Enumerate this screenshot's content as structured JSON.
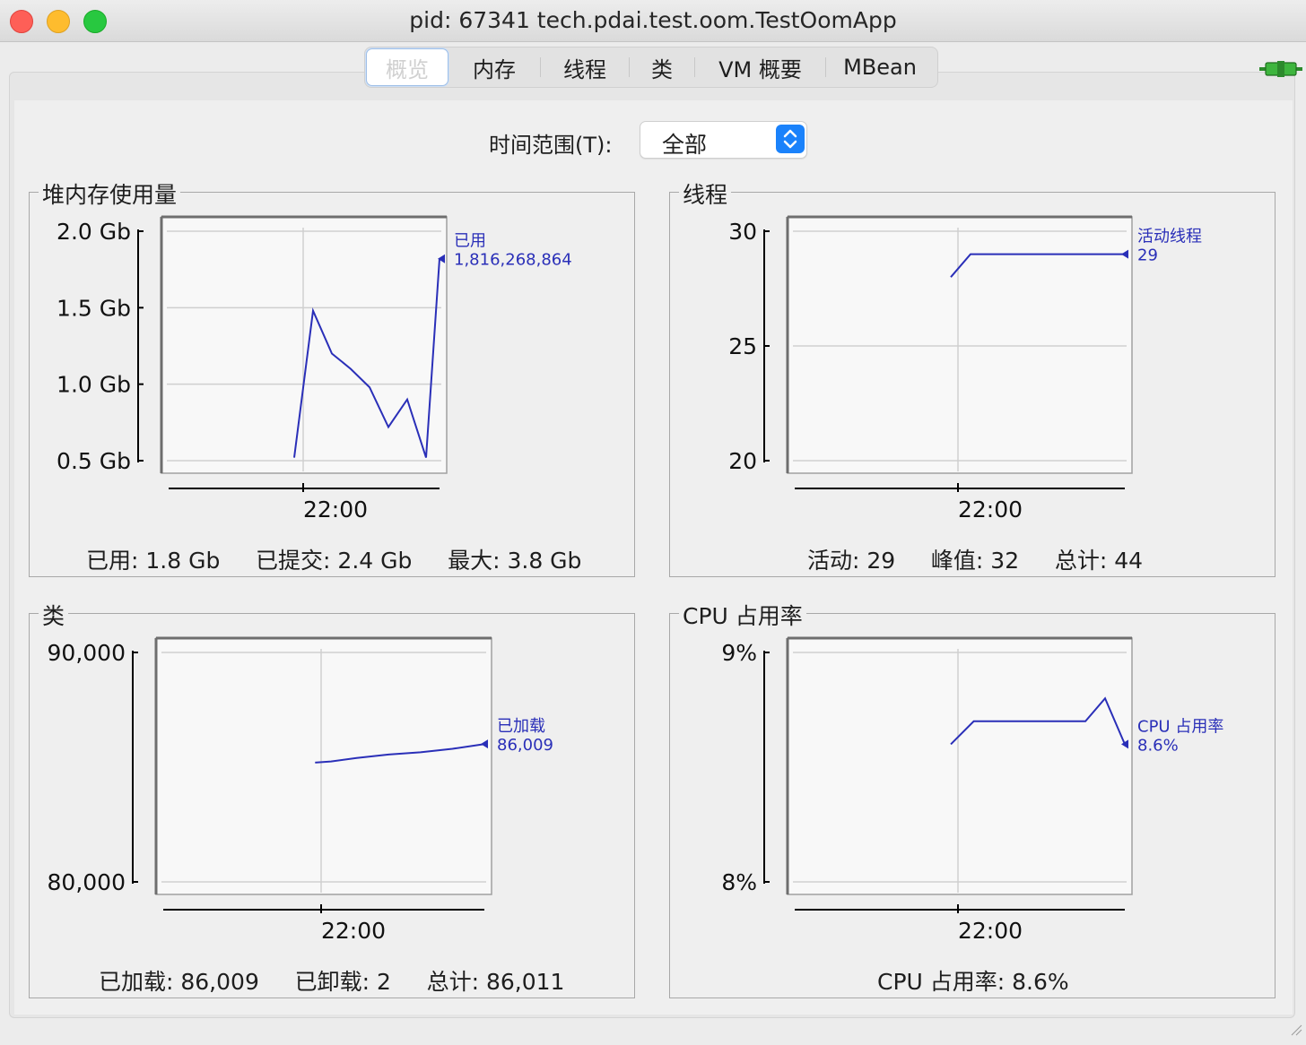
{
  "window": {
    "title": "pid: 67341 tech.pdai.test.oom.TestOomApp"
  },
  "tabs": [
    {
      "label": "概览",
      "active": true
    },
    {
      "label": "内存"
    },
    {
      "label": "线程"
    },
    {
      "label": "类"
    },
    {
      "label": "VM 概要"
    },
    {
      "label": "MBean"
    }
  ],
  "connection_icon": "plug-connected-icon",
  "time_range": {
    "label": "时间范围(T):",
    "value": "全部"
  },
  "colors": {
    "series": "#2a2fb8",
    "grid": "#cfcfcf",
    "plot_bg": "#f8f8f8"
  },
  "charts": {
    "heap": {
      "title": "堆内存使用量",
      "summary": "已用: 1.8 Gb     已提交: 2.4 Gb     最大: 3.8 Gb",
      "legend_name": "已用",
      "legend_value": "1,816,268,864"
    },
    "threads": {
      "title": "线程",
      "summary": "活动: 29     峰值: 32     总计: 44",
      "legend_name": "活动线程",
      "legend_value": "29"
    },
    "classes": {
      "title": "类",
      "summary": "已加载: 86,009     已卸载: 2     总计: 86,011",
      "legend_name": "已加载",
      "legend_value": "86,009"
    },
    "cpu": {
      "title": "CPU 占用率",
      "summary": "CPU 占用率: 8.6%",
      "legend_name": "CPU 占用率",
      "legend_value": "8.6%"
    }
  },
  "chart_data": [
    {
      "id": "heap",
      "type": "line",
      "title": "堆内存使用量",
      "x_tick_labels": [
        "22:00"
      ],
      "y_ticks": [
        0.5,
        1.0,
        1.5,
        2.0
      ],
      "y_tick_labels": [
        "0.5 Gb",
        "1.0 Gb",
        "1.5 Gb",
        "2.0 Gb"
      ],
      "ylim": [
        0.5,
        2.0
      ],
      "series": [
        {
          "name": "已用",
          "x": [
            0.46,
            0.53,
            0.6,
            0.67,
            0.74,
            0.81,
            0.88,
            0.95,
            1.0
          ],
          "y": [
            0.52,
            1.48,
            1.2,
            1.1,
            0.98,
            0.72,
            0.9,
            0.52,
            1.82
          ]
        }
      ]
    },
    {
      "id": "threads",
      "type": "line",
      "title": "线程",
      "x_tick_labels": [
        "22:00"
      ],
      "y_ticks": [
        20,
        25,
        30
      ],
      "y_tick_labels": [
        "20",
        "25",
        "30"
      ],
      "ylim": [
        20,
        30
      ],
      "series": [
        {
          "name": "活动线程",
          "x": [
            0.47,
            0.53,
            1.0
          ],
          "y": [
            28,
            29,
            29
          ]
        }
      ]
    },
    {
      "id": "classes",
      "type": "line",
      "title": "类",
      "x_tick_labels": [
        "22:00"
      ],
      "y_ticks": [
        80000,
        90000
      ],
      "y_tick_labels": [
        "80,000",
        "90,000"
      ],
      "ylim": [
        80000,
        90000
      ],
      "series": [
        {
          "name": "已加载",
          "x": [
            0.47,
            0.52,
            0.6,
            0.7,
            0.8,
            0.9,
            1.0
          ],
          "y": [
            85200,
            85250,
            85400,
            85550,
            85650,
            85800,
            86009
          ]
        }
      ]
    },
    {
      "id": "cpu",
      "type": "line",
      "title": "CPU 占用率",
      "x_tick_labels": [
        "22:00"
      ],
      "y_ticks": [
        8,
        9
      ],
      "y_tick_labels": [
        "8%",
        "9%"
      ],
      "ylim": [
        8,
        9
      ],
      "series": [
        {
          "name": "CPU 占用率",
          "x": [
            0.47,
            0.54,
            0.63,
            0.72,
            0.81,
            0.88,
            0.94,
            1.0
          ],
          "y": [
            8.6,
            8.7,
            8.7,
            8.7,
            8.7,
            8.7,
            8.8,
            8.6
          ]
        }
      ]
    }
  ]
}
